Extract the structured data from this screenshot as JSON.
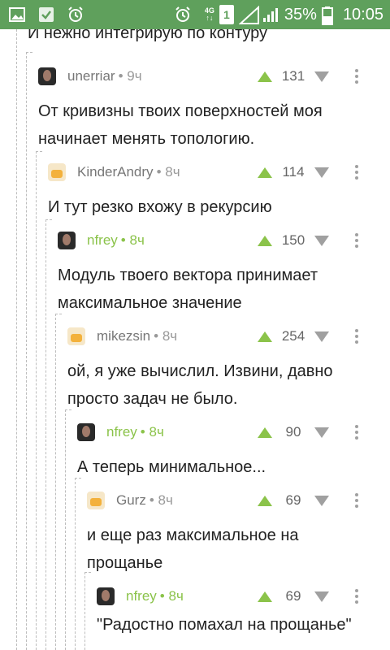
{
  "status_bar": {
    "network_label": "4G",
    "sim_label": "1",
    "battery_percent": "35%",
    "time": "10:05",
    "icons": [
      "image-icon",
      "check-icon",
      "alarm-icon",
      "alarm-icon",
      "signal-icon",
      "battery-icon"
    ]
  },
  "thread": {
    "top_text": "И нежно интегрирую по контуру",
    "comments": [
      {
        "author": "unerriar",
        "time": "9ч",
        "score": "131",
        "avatar": "dark",
        "text": [
          "От кривизны твоих поверхностей моя",
          "начинает менять топологию."
        ]
      },
      {
        "author": "KinderAndry",
        "time": "8ч",
        "score": "114",
        "avatar": "light",
        "text": [
          "И тут резко вхожу в рекурсию"
        ]
      },
      {
        "author": "nfrey",
        "time": "8ч",
        "score": "150",
        "avatar": "dark",
        "text": [
          "Модуль твоего вектора принимает",
          "максимальное значение"
        ]
      },
      {
        "author": "mikezsin",
        "time": "8ч",
        "score": "254",
        "avatar": "light",
        "text": [
          "ой, я уже вычислил. Извини, давно",
          "просто задач не было."
        ]
      },
      {
        "author": "nfrey",
        "time": "8ч",
        "score": "90",
        "avatar": "dark",
        "text": [
          "А теперь минимальное..."
        ]
      },
      {
        "author": "Gurz",
        "time": "8ч",
        "score": "69",
        "avatar": "light",
        "text": [
          "и еще раз максимальное на",
          "прощанье"
        ]
      },
      {
        "author": "nfrey",
        "time": "8ч",
        "score": "69",
        "avatar": "dark",
        "text": [
          "\"Радостно помахал на прощанье\""
        ]
      }
    ]
  },
  "colors": {
    "status_bar": "#5fa05c",
    "upvote": "#8bc34a",
    "highlight_author": "#8bc34a",
    "downvote": "#a0a0a0"
  }
}
